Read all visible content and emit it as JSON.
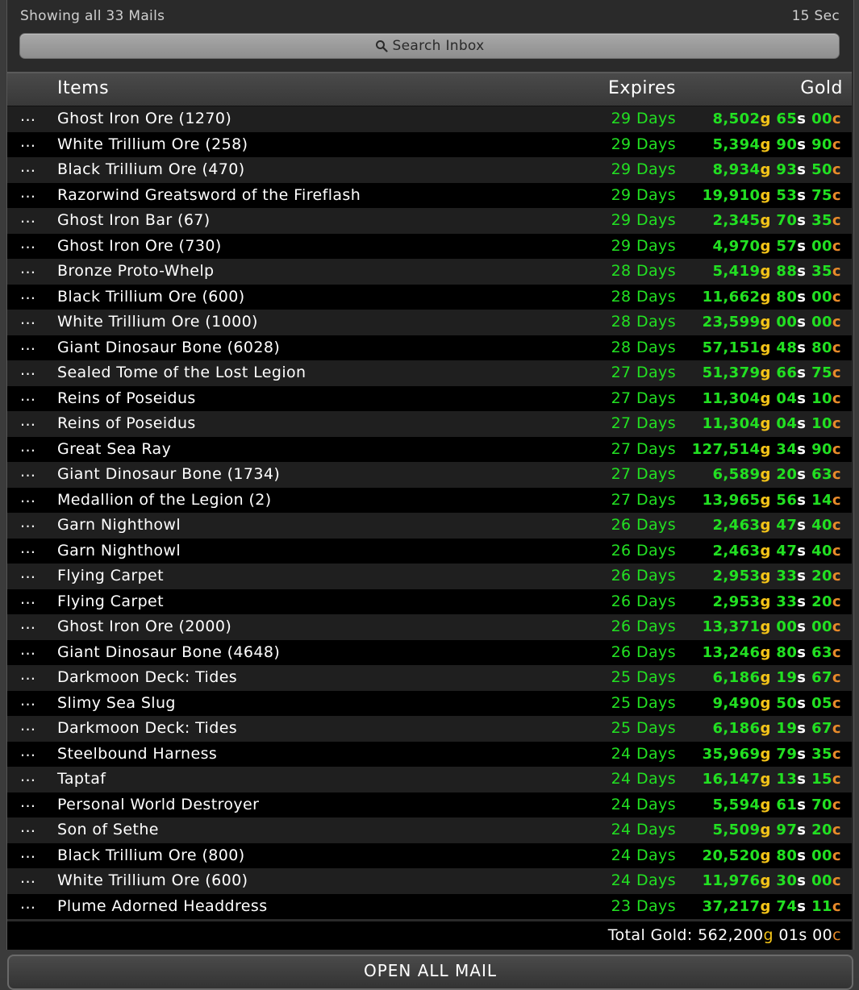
{
  "header": {
    "showing_text": "Showing all 33 Mails",
    "timer": "15 Sec",
    "search_label": "Search Inbox"
  },
  "columns": {
    "items": "Items",
    "expires": "Expires",
    "gold": "Gold"
  },
  "row_menu_label": "...",
  "mails": [
    {
      "item": "Ghost Iron Ore (1270)",
      "expires": "29 Days",
      "g": "8,502",
      "s": "65",
      "c": "00"
    },
    {
      "item": "White Trillium Ore (258)",
      "expires": "29 Days",
      "g": "5,394",
      "s": "90",
      "c": "90"
    },
    {
      "item": "Black Trillium Ore (470)",
      "expires": "29 Days",
      "g": "8,934",
      "s": "93",
      "c": "50"
    },
    {
      "item": "Razorwind Greatsword of the Fireflash",
      "expires": "29 Days",
      "g": "19,910",
      "s": "53",
      "c": "75"
    },
    {
      "item": "Ghost Iron Bar (67)",
      "expires": "29 Days",
      "g": "2,345",
      "s": "70",
      "c": "35"
    },
    {
      "item": "Ghost Iron Ore (730)",
      "expires": "29 Days",
      "g": "4,970",
      "s": "57",
      "c": "00"
    },
    {
      "item": "Bronze Proto-Whelp",
      "expires": "28 Days",
      "g": "5,419",
      "s": "88",
      "c": "35"
    },
    {
      "item": "Black Trillium Ore (600)",
      "expires": "28 Days",
      "g": "11,662",
      "s": "80",
      "c": "00"
    },
    {
      "item": "White Trillium Ore (1000)",
      "expires": "28 Days",
      "g": "23,599",
      "s": "00",
      "c": "00"
    },
    {
      "item": "Giant Dinosaur Bone (6028)",
      "expires": "28 Days",
      "g": "57,151",
      "s": "48",
      "c": "80"
    },
    {
      "item": "Sealed Tome of the Lost Legion",
      "expires": "27 Days",
      "g": "51,379",
      "s": "66",
      "c": "75"
    },
    {
      "item": "Reins of Poseidus",
      "expires": "27 Days",
      "g": "11,304",
      "s": "04",
      "c": "10"
    },
    {
      "item": "Reins of Poseidus",
      "expires": "27 Days",
      "g": "11,304",
      "s": "04",
      "c": "10"
    },
    {
      "item": "Great Sea Ray",
      "expires": "27 Days",
      "g": "127,514",
      "s": "34",
      "c": "90"
    },
    {
      "item": "Giant Dinosaur Bone (1734)",
      "expires": "27 Days",
      "g": "6,589",
      "s": "20",
      "c": "63"
    },
    {
      "item": "Medallion of the Legion (2)",
      "expires": "27 Days",
      "g": "13,965",
      "s": "56",
      "c": "14"
    },
    {
      "item": "Garn Nighthowl",
      "expires": "26 Days",
      "g": "2,463",
      "s": "47",
      "c": "40"
    },
    {
      "item": "Garn Nighthowl",
      "expires": "26 Days",
      "g": "2,463",
      "s": "47",
      "c": "40"
    },
    {
      "item": "Flying Carpet",
      "expires": "26 Days",
      "g": "2,953",
      "s": "33",
      "c": "20"
    },
    {
      "item": "Flying Carpet",
      "expires": "26 Days",
      "g": "2,953",
      "s": "33",
      "c": "20"
    },
    {
      "item": "Ghost Iron Ore (2000)",
      "expires": "26 Days",
      "g": "13,371",
      "s": "00",
      "c": "00"
    },
    {
      "item": "Giant Dinosaur Bone (4648)",
      "expires": "26 Days",
      "g": "13,246",
      "s": "80",
      "c": "63"
    },
    {
      "item": "Darkmoon Deck: Tides",
      "expires": "25 Days",
      "g": "6,186",
      "s": "19",
      "c": "67"
    },
    {
      "item": "Slimy Sea Slug",
      "expires": "25 Days",
      "g": "9,490",
      "s": "50",
      "c": "05"
    },
    {
      "item": "Darkmoon Deck: Tides",
      "expires": "25 Days",
      "g": "6,186",
      "s": "19",
      "c": "67"
    },
    {
      "item": "Steelbound Harness",
      "expires": "24 Days",
      "g": "35,969",
      "s": "79",
      "c": "35"
    },
    {
      "item": "Taptaf",
      "expires": "24 Days",
      "g": "16,147",
      "s": "13",
      "c": "15"
    },
    {
      "item": "Personal World Destroyer",
      "expires": "24 Days",
      "g": "5,594",
      "s": "61",
      "c": "70"
    },
    {
      "item": "Son of Sethe",
      "expires": "24 Days",
      "g": "5,509",
      "s": "97",
      "c": "20"
    },
    {
      "item": "Black Trillium Ore (800)",
      "expires": "24 Days",
      "g": "20,520",
      "s": "80",
      "c": "00"
    },
    {
      "item": "White Trillium Ore (600)",
      "expires": "24 Days",
      "g": "11,976",
      "s": "30",
      "c": "00"
    },
    {
      "item": "Plume Adorned Headdress",
      "expires": "23 Days",
      "g": "37,217",
      "s": "74",
      "c": "11"
    }
  ],
  "currency_suffix": {
    "g": "g",
    "s": "s",
    "c": "c"
  },
  "total": {
    "label": "Total Gold: ",
    "g": "562,200",
    "s": "01",
    "c": "00"
  },
  "open_all_label": "OPEN ALL MAIL",
  "colors": {
    "value_green": "#22e022",
    "gold_suffix": "#f5c518",
    "copper_suffix": "#e88a2a",
    "row_odd": "#1f1f1f",
    "row_even": "#000000"
  },
  "icons": {
    "search": "search-icon"
  }
}
